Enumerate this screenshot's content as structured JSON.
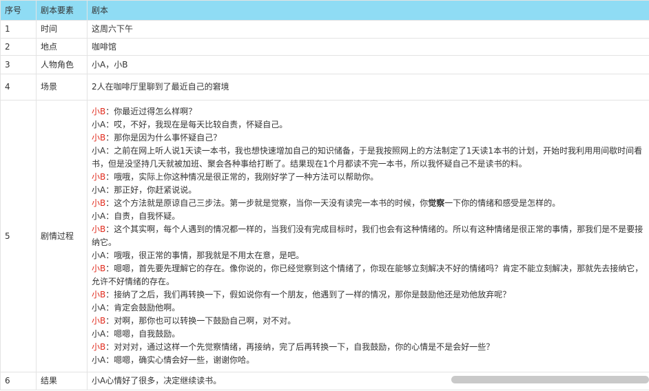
{
  "headers": [
    "序号",
    "剧本要素",
    "剧本"
  ],
  "rows": [
    {
      "num": "1",
      "element": "时间",
      "content": "这周六下午"
    },
    {
      "num": "2",
      "element": "地点",
      "content": "咖啡馆"
    },
    {
      "num": "3",
      "element": "人物角色",
      "content": "小A，小B"
    },
    {
      "num": "4",
      "element": "场景",
      "content": "2人在咖啡厅里聊到了最近自己的窘境"
    },
    {
      "num": "5",
      "element": "剧情过程"
    },
    {
      "num": "6",
      "element": "结果",
      "content": "小A心情好了很多，决定继续读书。"
    }
  ],
  "dialogue": [
    {
      "speaker": "小B",
      "text": "：你最近过得怎么样啊？"
    },
    {
      "speaker": "小A",
      "text": "：哎，不好，我现在是每天比较自责，怀疑自己。"
    },
    {
      "speaker": "小B",
      "text": "：那你是因为什么事怀疑自己？"
    },
    {
      "speaker": "小A",
      "text": "：之前在网上听人说1天读一本书，我也想快速增加自己的知识储备，于是我按照网上的方法制定了1天读1本书的计划，开始时我利用用间歇时间看书，但是没坚持几天就被加班、聚会各种事给打断了。结果现在1个月都读不完一本书，所以我怀疑自己不是读书的料。"
    },
    {
      "speaker": "小B",
      "text": "：哦哦，实际上你这种情况是很正常的，我刚好学了一种方法可以帮助你。"
    },
    {
      "speaker": "小A",
      "text": "：那正好，你赶紧说说。"
    },
    {
      "speaker": "小B",
      "text": "：这个方法就是原谅自己三步法。第一步就是觉察，当你一天没有读完一本书的时候，你",
      "bold": "觉察",
      "text2": "一下你的情绪和感受是怎样的。"
    },
    {
      "speaker": "小A",
      "text": "：自责，自我怀疑。"
    },
    {
      "speaker": "小B",
      "text": "：这个其实啊，每个人遇到的情况都一样的，当我们没有完成目标时，我们也会有这种情绪的。所以有这种情绪是很正常的事情，那我们是不是要接纳它。"
    },
    {
      "speaker": "小A",
      "text": "：哦哦，很正常的事情，那我就是不用太在意，是吧。"
    },
    {
      "speaker": "小B",
      "text": "：嗯嗯，首先要先理解它的存在。像你说的，你已经觉察到这个情绪了，你现在能够立刻解决不好的情绪吗？肯定不能立刻解决，那就先去接纳它，允许不好情绪的存在。"
    },
    {
      "speaker": "小B",
      "text": "：接纳了之后，我们再转换一下，假如说你有一个朋友，他遇到了一样的情况，那你是鼓励他还是劝他放弃呢？"
    },
    {
      "speaker": "小A",
      "text": "：肯定会鼓励他啊。"
    },
    {
      "speaker": "小B",
      "text": "：对啊，那你也可以转换一下鼓励自己啊，对不对。"
    },
    {
      "speaker": "小A",
      "text": "：嗯嗯，自我鼓励。"
    },
    {
      "speaker": "小B",
      "text": "：对对对，通过这样一个先觉察情绪，再接纳，完了后再转换一下，自我鼓励，你的心情是不是会好一些？"
    },
    {
      "speaker": "小A",
      "text": "：嗯嗯，确实心情会好一些，谢谢你哈。"
    }
  ],
  "colors": {
    "header_bg": "#8fdcf4",
    "speaker_b": "#e0291b",
    "grid": "#e3e3e3"
  }
}
